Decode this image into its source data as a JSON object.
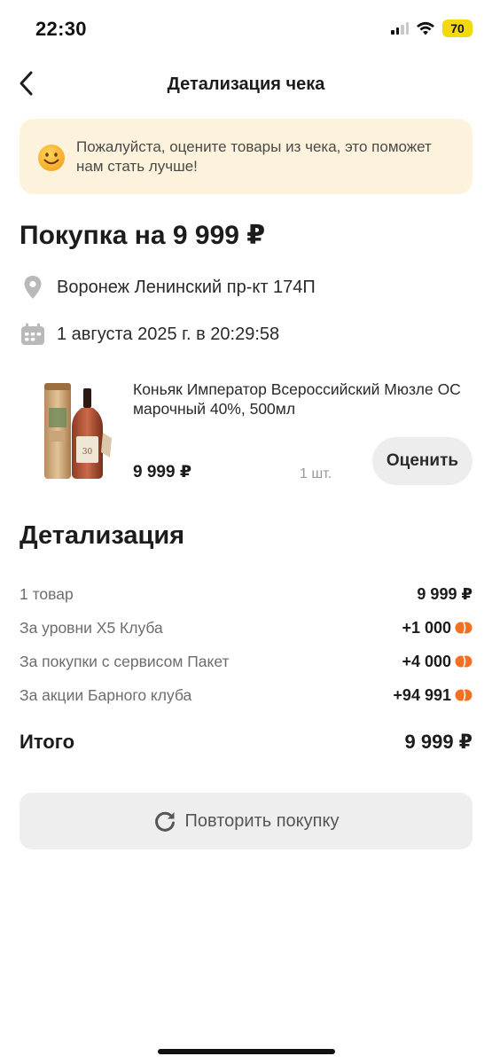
{
  "status_bar": {
    "time": "22:30",
    "battery": "70",
    "battery_color": "#f4d90c"
  },
  "nav": {
    "title": "Детализация чека",
    "back_icon": "chevron-left-icon"
  },
  "banner": {
    "icon": "smiley-icon",
    "text": "Пожалуйста, оцените товары из чека, это поможет нам стать лучше!",
    "background": "#fdf3dd"
  },
  "purchase": {
    "title": "Покупка на 9 999 ₽",
    "location_icon": "location-pin-icon",
    "location": "Воронеж Ленинский пр-кт 174П",
    "date_icon": "calendar-icon",
    "date": "1 августа 2025 г. в 20:29:58"
  },
  "product": {
    "image_icon": "cognac-bottle-image",
    "name": "Коньяк Император Всероссийский Мюзле ОС марочный 40%, 500мл",
    "price": "9 999 ₽",
    "quantity": "1 шт.",
    "rate_label": "Оценить"
  },
  "details": {
    "title": "Детализация",
    "rows": [
      {
        "label": "1 товар",
        "value": "9 999 ₽",
        "coin": false
      },
      {
        "label": "За уровни Х5 Клуба",
        "value": "+1 000",
        "coin": true
      },
      {
        "label": "За покупки с сервисом Пакет",
        "value": "+4 000",
        "coin": true
      },
      {
        "label": "За акции Барного клуба",
        "value": "+94 991",
        "coin": true
      }
    ],
    "coin_color": "#f36f21",
    "total_label": "Итого",
    "total_value": "9 999 ₽"
  },
  "repeat": {
    "icon": "refresh-icon",
    "label": "Повторить покупку"
  }
}
